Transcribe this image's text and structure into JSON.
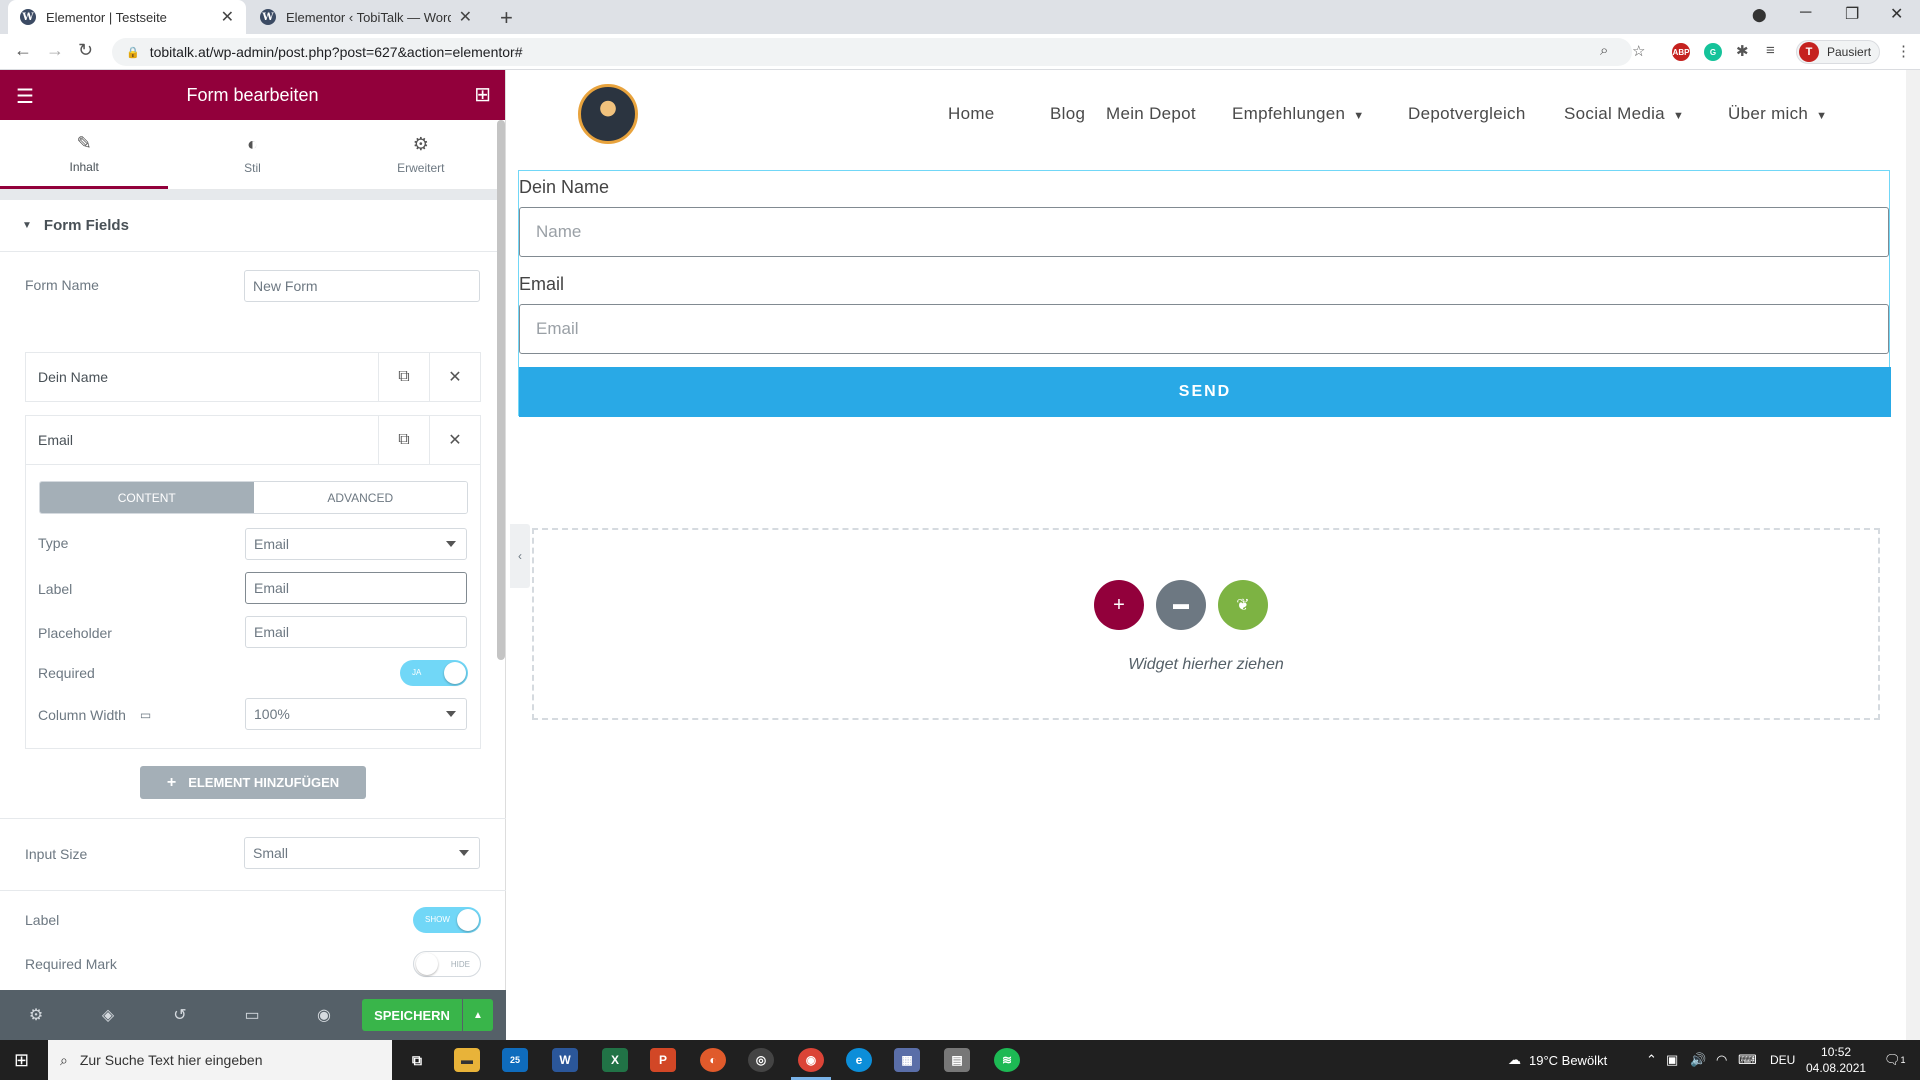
{
  "browser": {
    "tabs": [
      {
        "title": "Elementor | Testseite",
        "active": true
      },
      {
        "title": "Elementor ‹ TobiTalk — WordPre",
        "active": false
      }
    ],
    "url": "tobitalk.at/wp-admin/post.php?post=627&action=elementor#",
    "profile_label": "Pausiert",
    "profile_initial": "T",
    "ext_abp": "ABP"
  },
  "panel": {
    "title": "Form bearbeiten",
    "tabs": [
      "Inhalt",
      "Stil",
      "Erweitert"
    ],
    "section_title": "Form Fields",
    "form_name_label": "Form Name",
    "form_name_value": "New Form",
    "fields": [
      "Dein Name",
      "Email"
    ],
    "inner_tabs": [
      "Content",
      "Advanced"
    ],
    "type_label": "Type",
    "type_value": "Email",
    "label_label": "Label",
    "label_value": "Email",
    "placeholder_label": "Placeholder",
    "placeholder_value": "Email",
    "required_label": "Required",
    "required_toggle": "Ja",
    "column_width_label": "Column Width",
    "column_width_value": "100%",
    "add_element": "Element hinzufügen",
    "input_size_label": "Input Size",
    "input_size_value": "Small",
    "label2_label": "Label",
    "label2_toggle": "Show",
    "required_mark_label": "Required Mark",
    "required_mark_toggle": "Hide",
    "save": "Speichern"
  },
  "site": {
    "nav": [
      "Home",
      "Blog",
      "Mein Depot",
      "Empfehlungen",
      "Depotvergleich",
      "Social Media",
      "Über mich"
    ],
    "form": {
      "name_label": "Dein Name",
      "name_placeholder": "Name",
      "email_label": "Email",
      "email_placeholder": "Email",
      "send": "SEND"
    },
    "drop_text": "Widget hierher ziehen"
  },
  "colors": {
    "elementor_brand": "#92003b",
    "send_button": "#29a9e6",
    "save_button": "#39b54a",
    "toggle_on": "#71d7f7"
  },
  "taskbar": {
    "search": "Zur Suche Text hier eingeben",
    "mail_badge": "25",
    "weather": "19°C  Bewölkt",
    "lang": "DEU",
    "time": "10:52",
    "date": "04.08.2021",
    "notif_count": "1"
  }
}
